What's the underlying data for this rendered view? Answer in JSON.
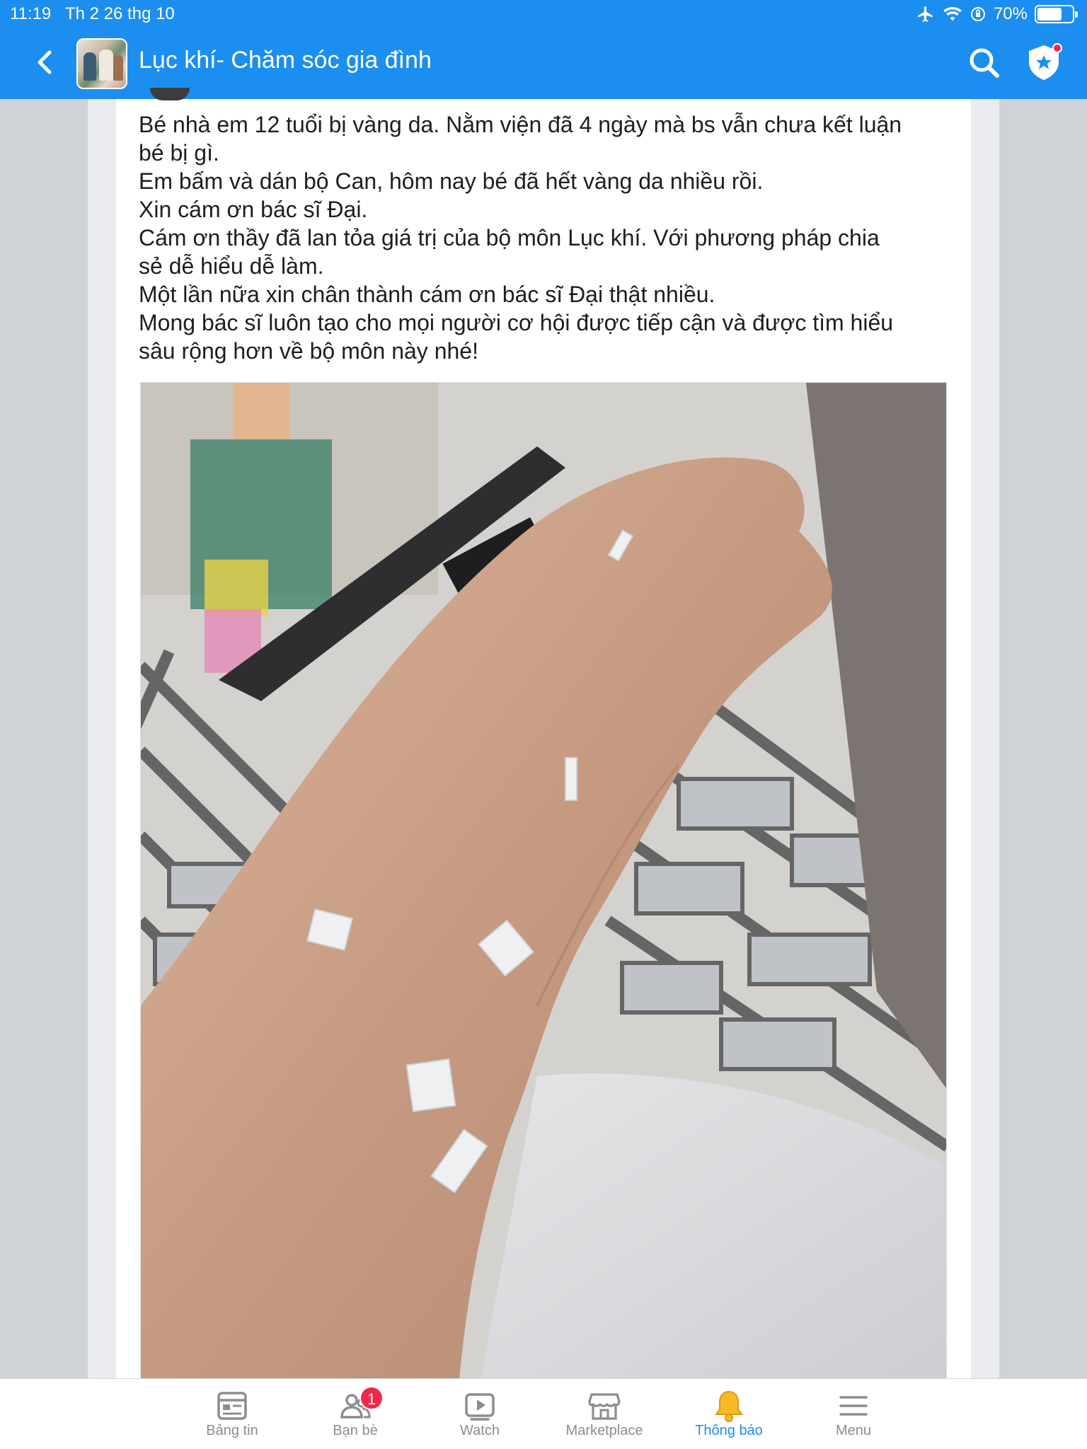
{
  "status_bar": {
    "time": "11:19",
    "date": "Th 2 26 thg 10",
    "battery": "70%",
    "battery_level": 0.7
  },
  "header": {
    "group_name": "Lục khí- Chăm sóc gia đình",
    "accent_color": "#1b8ef0"
  },
  "post": {
    "lines": [
      "Bé nhà em 12 tuổi bị vàng da. Nằm viện đã 4 ngày mà bs vẫn chưa kết luận",
      "bé bị gì.",
      "Em bấm và dán bộ Can, hôm nay bé đã hết vàng da nhiều rồi.",
      "Xin cám ơn bác sĩ Đại.",
      "Cám ơn thầy đã lan tỏa giá trị của bộ môn Lục khí. Với phương pháp chia",
      "sẻ dễ hiểu dễ làm.",
      "Một lần nữa xin chân thành cám ơn bác sĩ Đại thật nhiều.",
      "Mong bác sĩ luôn tạo cho mọi người cơ hội được tiếp cận và được tìm hiểu",
      "sâu rộng hơn về bộ môn này nhé!"
    ]
  },
  "tabs": [
    {
      "label": "Bảng tin",
      "icon": "news-feed-icon",
      "active": false
    },
    {
      "label": "Bạn bè",
      "icon": "friends-icon",
      "active": false,
      "badge": "1"
    },
    {
      "label": "Watch",
      "icon": "watch-icon",
      "active": false
    },
    {
      "label": "Marketplace",
      "icon": "marketplace-icon",
      "active": false
    },
    {
      "label": "Thông báo",
      "icon": "bell-icon",
      "active": true
    },
    {
      "label": "Menu",
      "icon": "menu-icon",
      "active": false
    }
  ]
}
